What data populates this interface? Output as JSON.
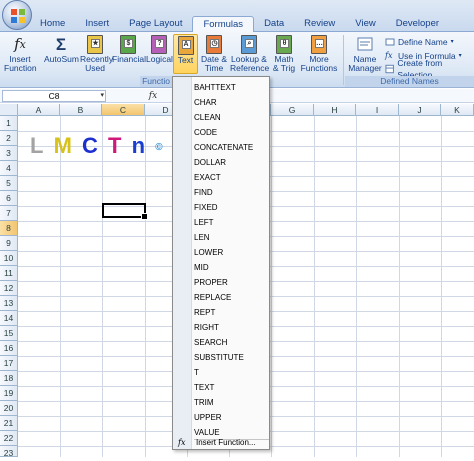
{
  "ribbon_tabs": [
    "Home",
    "Insert",
    "Page Layout",
    "Formulas",
    "Data",
    "Review",
    "View",
    "Developer"
  ],
  "active_tab": "Formulas",
  "ribbon": {
    "insert_function": "Insert\nFunction",
    "autosum": "AutoSum",
    "recently_used": "Recently\nUsed",
    "financial": "Financial",
    "logical": "Logical",
    "text": "Text",
    "date_time": "Date &\nTime",
    "lookup_reference": "Lookup &\nReference",
    "math_trig": "Math\n& Trig",
    "more_functions": "More\nFunctions",
    "function_library_label": "Functio",
    "name_manager": "Name\nManager",
    "define_name": "Define Name",
    "use_in_formula": "Use in Formula",
    "create_from_selection": "Create from Selection",
    "defined_names_label": "Defined Names"
  },
  "formula_bar": {
    "name_box": "C8",
    "fx": "fx"
  },
  "columns": [
    "A",
    "B",
    "C",
    "D",
    "E",
    "F",
    "G",
    "H",
    "I",
    "J",
    "K"
  ],
  "rows": [
    "1",
    "2",
    "3",
    "4",
    "5",
    "6",
    "7",
    "8",
    "9",
    "10",
    "11",
    "12",
    "13",
    "14",
    "15",
    "16",
    "17",
    "18",
    "19",
    "20",
    "21",
    "22",
    "23"
  ],
  "selected_cell": "C8",
  "cell_art": {
    "L": "L",
    "M": "M",
    "C": "C",
    "T": "T",
    "n": "n",
    "copy": "©"
  },
  "text_functions": [
    "BAHTTEXT",
    "CHAR",
    "CLEAN",
    "CODE",
    "CONCATENATE",
    "DOLLAR",
    "EXACT",
    "FIND",
    "FIXED",
    "LEFT",
    "LEN",
    "LOWER",
    "MID",
    "PROPER",
    "REPLACE",
    "REPT",
    "RIGHT",
    "SEARCH",
    "SUBSTITUTE",
    "T",
    "TEXT",
    "TRIM",
    "UPPER",
    "VALUE"
  ],
  "insert_function_item": "Insert Function...",
  "colors": {
    "accent": "#15428b",
    "active_orange": "#ffd35e"
  }
}
